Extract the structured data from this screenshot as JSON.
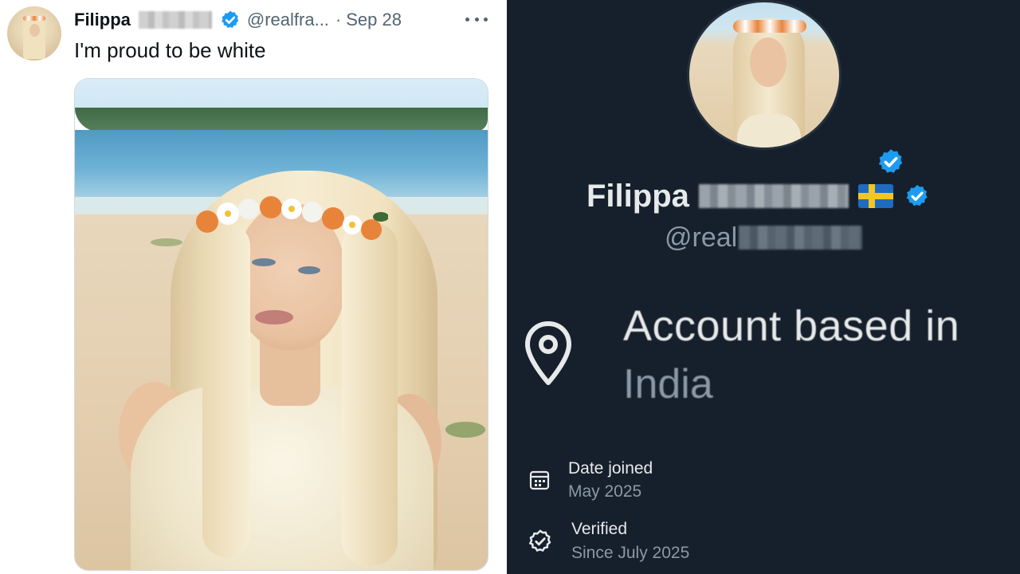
{
  "tweet": {
    "display_name": "Filippa",
    "handle": "@realfra...",
    "separator": "·",
    "date": "Sep 28",
    "text": "I'm proud to be white",
    "more_icon": "more-horizontal-icon",
    "verified_icon": "verified-badge-icon"
  },
  "profile": {
    "display_name": "Filippa",
    "flag": "sweden-flag",
    "handle_prefix": "@real",
    "location_title": "Account based in",
    "location_value": "India",
    "date_joined_title": "Date joined",
    "date_joined_value": "May 2025",
    "verified_title": "Verified",
    "verified_value": "Since July 2025",
    "icons": [
      "location-pin-icon",
      "calendar-icon",
      "verified-check-icon"
    ]
  },
  "colors": {
    "verified_blue": "#1d9bf0",
    "dark_bg": "#16202c",
    "muted_text": "#8b98a5"
  }
}
